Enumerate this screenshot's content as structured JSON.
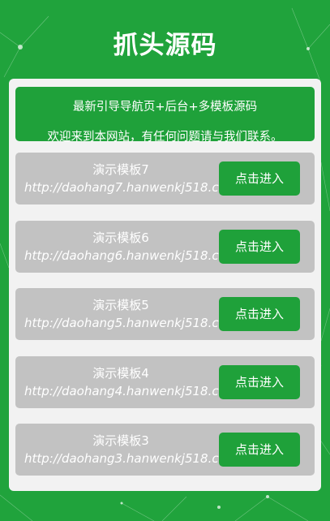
{
  "header": {
    "title": "抓头源码"
  },
  "notice": {
    "line1": "最新引导导航页+后台+多模板源码",
    "line2": "欢迎来到本网站，有任何问题请与我们联系。"
  },
  "templates": [
    {
      "name": "演示模板7",
      "url": "http://daohang7.hanwenkj518.cn",
      "button": "点击进入"
    },
    {
      "name": "演示模板6",
      "url": "http://daohang6.hanwenkj518.cn",
      "button": "点击进入"
    },
    {
      "name": "演示模板5",
      "url": "http://daohang5.hanwenkj518.cn",
      "button": "点击进入"
    },
    {
      "name": "演示模板4",
      "url": "http://daohang4.hanwenkj518.cn",
      "button": "点击进入"
    },
    {
      "name": "演示模板3",
      "url": "http://daohang3.hanwenkj518.cn",
      "button": "点击进入"
    }
  ],
  "colors": {
    "background": "#20a33c",
    "accent": "#1fa13a",
    "item_bg": "#c2c2c2",
    "card_bg": "#f2f2f2"
  }
}
